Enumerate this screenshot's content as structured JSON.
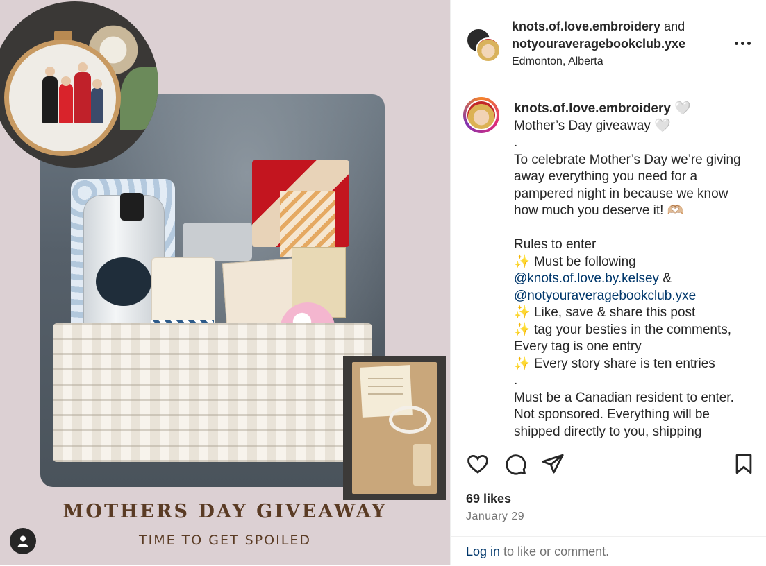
{
  "post_image": {
    "title": "MOTHERS DAY GIVEAWAY",
    "subtitle": "TIME TO GET SPOILED",
    "tagged_users_icon": "person-icon"
  },
  "header": {
    "author": "knots.of.love.embroidery",
    "conjunction": "and",
    "collaborator": "notyouraveragebookclub.yxe",
    "location": "Edmonton, Alberta",
    "more_icon": "more-horizontal-icon"
  },
  "caption": {
    "username": "knots.of.love.embroidery",
    "heart": "🤍",
    "line1": "Mother’s Day giveaway ",
    "dot1": ".",
    "paragraph1": "To celebrate Mother’s Day we’re giving away everything you need for a pampered night in because we know how much you deserve it! 🫶🏼",
    "rules_heading": "Rules to enter",
    "sparkle": "✨",
    "rule1": " Must be following",
    "mention1": "@knots.of.love.by.kelsey",
    "amp": " &",
    "mention2": "@notyouraveragebookclub.yxe",
    "rule2": " Like, save & share this post",
    "rule3": " tag your besties in the comments, Every tag is one entry",
    "rule4": " Every story share is ten entries",
    "dot2": ".",
    "paragraph2": "Must be a Canadian resident to enter. Not sponsored. Everything will be shipped directly to you, shipping"
  },
  "actions": {
    "like_icon": "heart-icon",
    "comment_icon": "comment-icon",
    "share_icon": "share-icon",
    "save_icon": "bookmark-icon"
  },
  "stats": {
    "likes": "69 likes",
    "date": "January 29"
  },
  "login": {
    "link": "Log in",
    "text": " to like or comment."
  }
}
